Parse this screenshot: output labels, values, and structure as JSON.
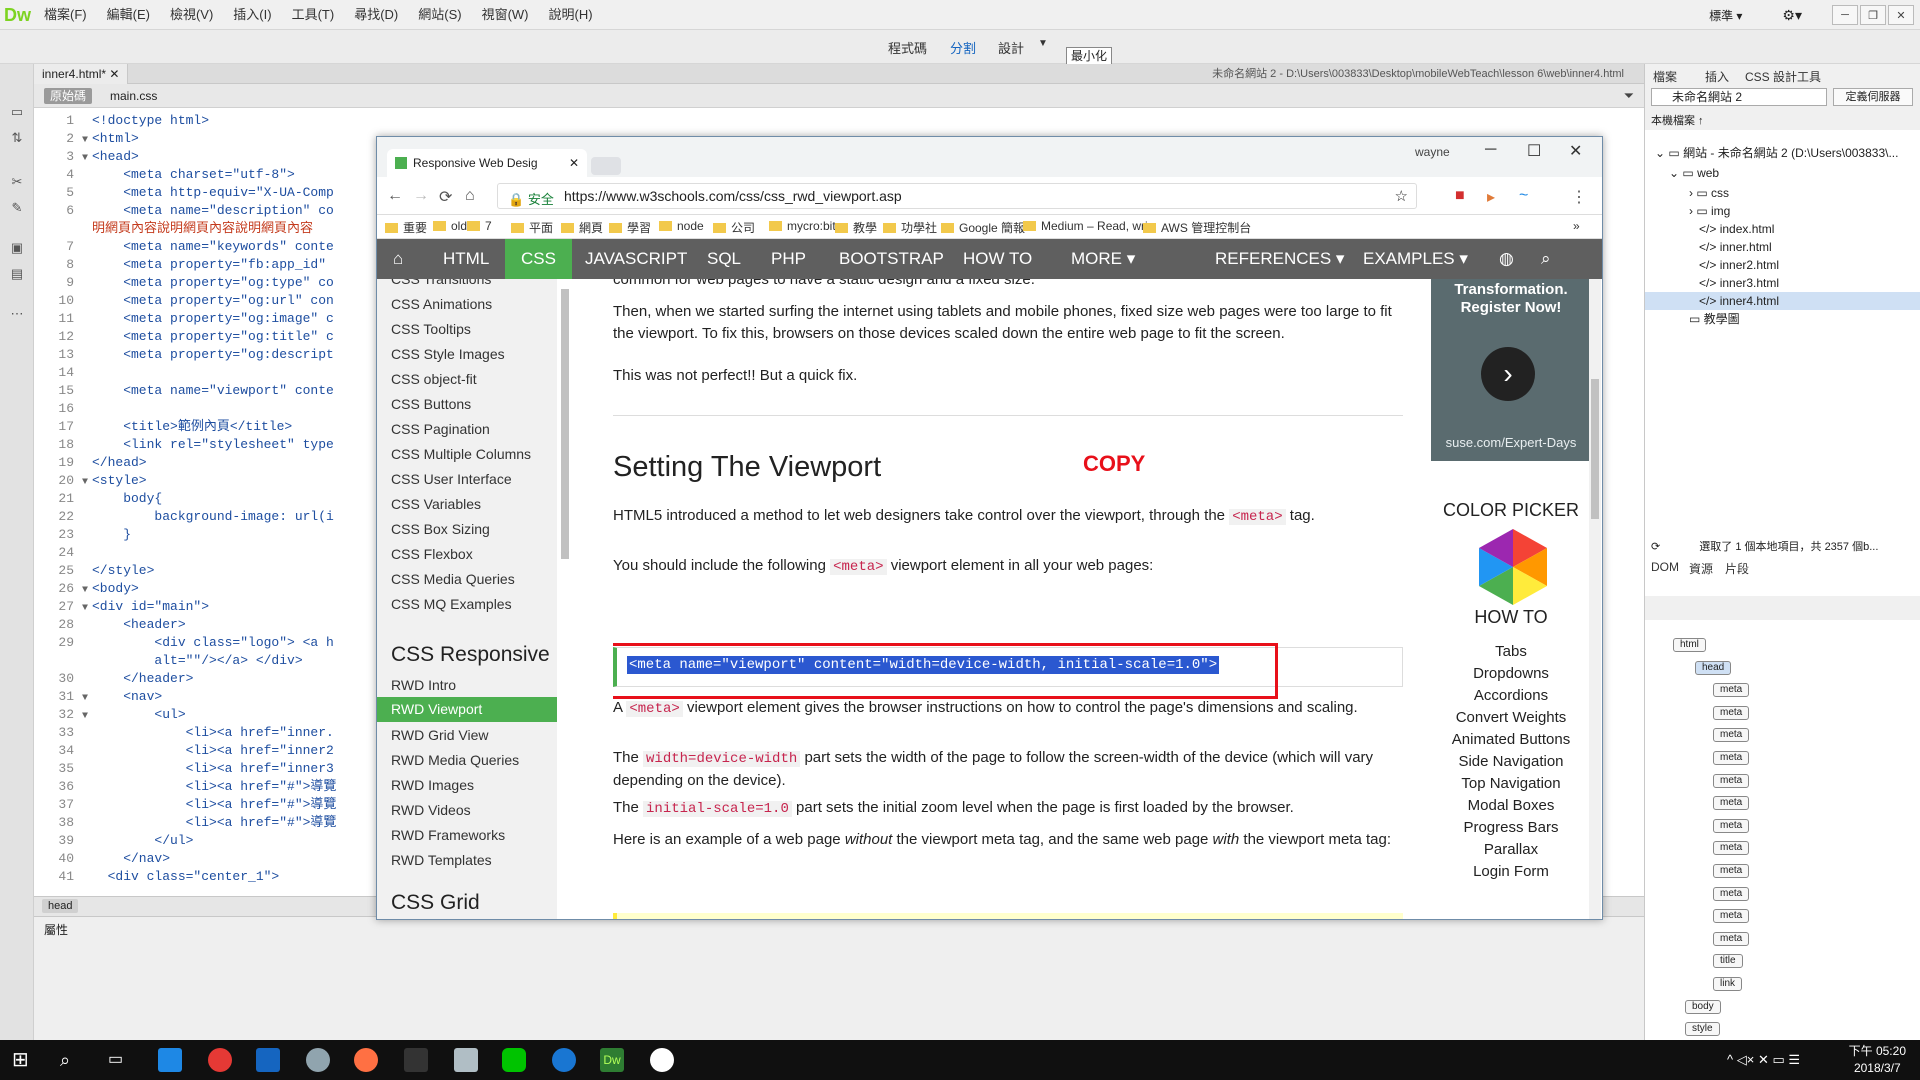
{
  "dw": {
    "logo": "Dw",
    "menus": [
      "檔案(F)",
      "編輯(E)",
      "檢視(V)",
      "插入(I)",
      "工具(T)",
      "尋找(D)",
      "網站(S)",
      "視窗(W)",
      "說明(H)"
    ],
    "workspace": "標準 ▾",
    "views": {
      "code": "程式碼",
      "split": "分割",
      "design": "設計"
    },
    "tooltip": "最小化",
    "doc_tab": "inner4.html*",
    "doc_path": "未命名網站 2 - D:\\Users\\003833\\Desktop\\mobileWebTeach\\lesson 6\\web\\inner4.html",
    "src_tabs": [
      "原始碼",
      "main.css"
    ],
    "status_tag": "head",
    "properties_label": "屬性"
  },
  "code_lines": [
    [
      "1",
      "<!doctype html>"
    ],
    [
      "2",
      "<html>"
    ],
    [
      "3",
      "<head>"
    ],
    [
      "4",
      "    <meta charset=\"utf-8\">"
    ],
    [
      "5",
      "    <meta http-equiv=\"X-UA-Comp"
    ],
    [
      "6",
      "    <meta name=\"description\" co"
    ],
    [
      "",
      "明網頁內容說明網頁內容說明網頁內容"
    ],
    [
      "7",
      "    <meta name=\"keywords\" conte"
    ],
    [
      "8",
      "    <meta property=\"fb:app_id\" "
    ],
    [
      "9",
      "    <meta property=\"og:type\" co"
    ],
    [
      "10",
      "    <meta property=\"og:url\" con"
    ],
    [
      "11",
      "    <meta property=\"og:image\" c"
    ],
    [
      "12",
      "    <meta property=\"og:title\" c"
    ],
    [
      "13",
      "    <meta property=\"og:descript"
    ],
    [
      "14",
      ""
    ],
    [
      "15",
      "    <meta name=\"viewport\" conte"
    ],
    [
      "16",
      ""
    ],
    [
      "17",
      "    <title>範例內頁</title>"
    ],
    [
      "18",
      "    <link rel=\"stylesheet\" type"
    ],
    [
      "19",
      "</head>"
    ],
    [
      "20",
      "<style>"
    ],
    [
      "21",
      "    body{"
    ],
    [
      "22",
      "        background-image: url(i"
    ],
    [
      "23",
      "    }"
    ],
    [
      "24",
      ""
    ],
    [
      "25",
      "</style>"
    ],
    [
      "26",
      "<body>"
    ],
    [
      "27",
      "<div id=\"main\">"
    ],
    [
      "28",
      "    <header>"
    ],
    [
      "29",
      "        <div class=\"logo\"> <a h"
    ],
    [
      "",
      "        alt=\"\"/></a> </div>"
    ],
    [
      "30",
      "    </header>"
    ],
    [
      "31",
      "    <nav>"
    ],
    [
      "32",
      "        <ul>"
    ],
    [
      "33",
      "            <li><a href=\"inner."
    ],
    [
      "34",
      "            <li><a href=\"inner2"
    ],
    [
      "35",
      "            <li><a href=\"inner3"
    ],
    [
      "36",
      "            <li><a href=\"#\">導覽"
    ],
    [
      "37",
      "            <li><a href=\"#\">導覽"
    ],
    [
      "38",
      "            <li><a href=\"#\">導覽"
    ],
    [
      "39",
      "        </ul>"
    ],
    [
      "40",
      "    </nav>"
    ],
    [
      "41",
      "  <div class=\"center_1\">"
    ]
  ],
  "files_panel": {
    "tabs": [
      "檔案",
      "插入",
      "CSS 設計工具"
    ],
    "site_select": "未命名網站 2",
    "define_btn": "定義伺服器",
    "local_files": "本機檔案 ↑",
    "tree": [
      "網站 - 未命名網站 2 (D:\\Users\\003833\\...",
      "web",
      "css",
      "img",
      "index.html",
      "inner.html",
      "inner2.html",
      "inner3.html",
      "inner4.html",
      "教學圖"
    ],
    "status": "選取了 1 個本地項目，共 2357 個b..."
  },
  "dom_panel": {
    "tabs": [
      "DOM",
      "資源",
      "片段"
    ],
    "nodes": [
      "html",
      "head",
      "meta",
      "meta",
      "meta",
      "meta",
      "meta",
      "meta",
      "meta",
      "meta",
      "meta",
      "meta",
      "meta",
      "meta",
      "title",
      "link",
      "body",
      "style"
    ]
  },
  "browser": {
    "tab_title": "Responsive Web Desig",
    "user": "wayne",
    "secure": "安全",
    "url": "https://www.w3schools.com/css/css_rwd_viewport.asp",
    "bookmarks": [
      "重要",
      "old",
      "7",
      "平面",
      "網頁",
      "學習",
      "node",
      "公司",
      "mycro:bit",
      "教學",
      "功學社",
      "Google 簡報",
      "Medium – Read, wri",
      "AWS 管理控制台"
    ],
    "nav": [
      "HTML",
      "CSS",
      "JAVASCRIPT",
      "SQL",
      "PHP",
      "BOOTSTRAP",
      "HOW TO",
      "MORE ▾",
      "REFERENCES ▾",
      "EXAMPLES ▾"
    ],
    "side_links": [
      "CSS Transitions",
      "CSS Animations",
      "CSS Tooltips",
      "CSS Style Images",
      "CSS object-fit",
      "CSS Buttons",
      "CSS Pagination",
      "CSS Multiple Columns",
      "CSS User Interface",
      "CSS Variables",
      "CSS Box Sizing",
      "CSS Flexbox",
      "CSS Media Queries",
      "CSS MQ Examples"
    ],
    "side_heading": "CSS Responsive",
    "rwd_links": [
      "RWD Intro",
      "RWD Viewport",
      "RWD Grid View",
      "RWD Media Queries",
      "RWD Images",
      "RWD Videos",
      "RWD Frameworks",
      "RWD Templates"
    ],
    "side_heading2": "CSS Grid",
    "p_top": "common for web pages to have a static design and a fixed size.",
    "p1": "Then, when we started surfing the internet using tablets and mobile phones, fixed size web pages were too large to fit the viewport. To fix this, browsers on those devices scaled down the entire web page to fit the screen.",
    "p2": "This was not perfect!! But a quick fix.",
    "heading": "Setting The Viewport",
    "copy": "COPY",
    "p3a": "HTML5 introduced a method to let web designers take control over the viewport, through the",
    "p3code": "<meta>",
    "p3b": "tag.",
    "p4a": "You should include the following",
    "p4code": "<meta>",
    "p4b": "viewport element in all your web pages:",
    "code_snippet": "<meta name=\"viewport\" content=\"width=device-width, initial-scale=1.0\">",
    "p5a": "A",
    "p5code": "<meta>",
    "p5b": "viewport element gives the browser instructions on how to control the page's dimensions and scaling.",
    "p6a": "The",
    "p6code": "width=device-width",
    "p6b": "part sets the width of the page to follow the screen-width of the device (which will vary depending on the device).",
    "p7a": "The",
    "p7code": "initial-scale=1.0",
    "p7b": "part sets the initial zoom level when the page is first loaded by the browser.",
    "p8a": "Here is an example of a web page",
    "p8em1": "without",
    "p8b": "the viewport meta tag, and the same web page",
    "p8em2": "with",
    "p8c": "the viewport meta tag:",
    "ad_line1": "Transformation.",
    "ad_line2": "Register Now!",
    "ad_url": "suse.com/Expert-Days",
    "color_picker": "COLOR PICKER",
    "howto": "HOW TO",
    "howto_items": [
      "Tabs",
      "Dropdowns",
      "Accordions",
      "Convert Weights",
      "Animated Buttons",
      "Side Navigation",
      "Top Navigation",
      "Modal Boxes",
      "Progress Bars",
      "Parallax",
      "Login Form"
    ]
  },
  "taskbar": {
    "time": "下午 05:20",
    "date": "2018/3/7"
  }
}
